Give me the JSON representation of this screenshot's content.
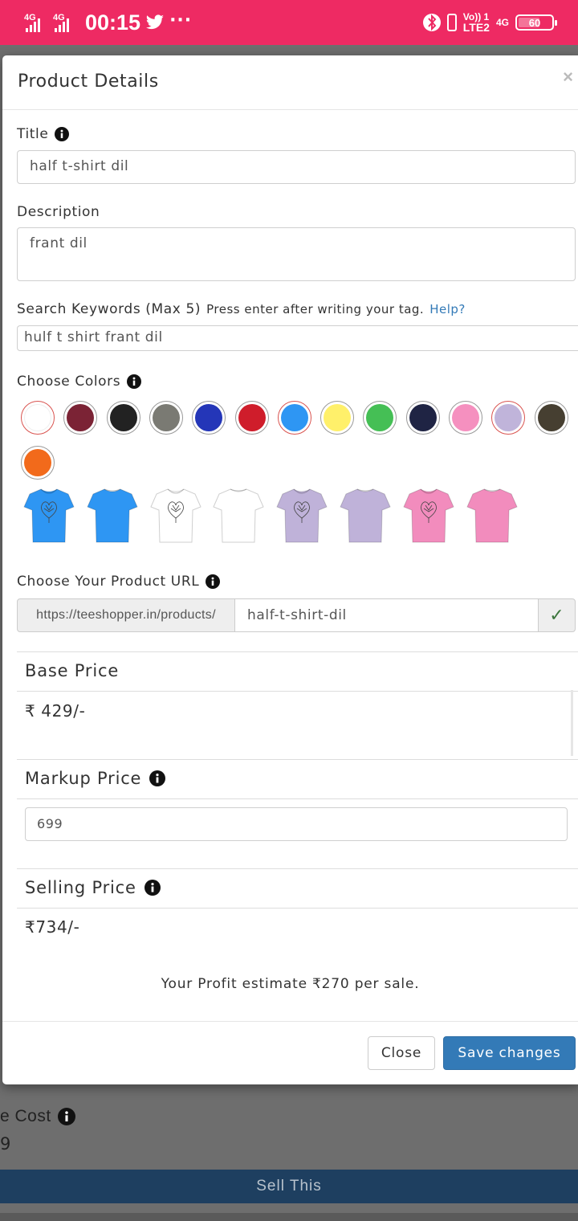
{
  "status_bar": {
    "signal1": "4G",
    "signal2": "4G",
    "time": "00:15",
    "more": "···",
    "volte": "Vo)) 1",
    "lte": "LTE2",
    "net3": "4G",
    "battery": "60"
  },
  "background": {
    "cost_label": "e Cost",
    "cost_value": "9",
    "sell_button": "Sell This"
  },
  "modal": {
    "title": "Product Details",
    "close_x": "×",
    "title_label": "Title",
    "title_value": "half t-shirt dil",
    "description_label": "Description",
    "description_value": "frant dil",
    "keywords_label": "Search Keywords (Max 5)",
    "keywords_hint": "Press enter after writing your tag.",
    "keywords_help": "Help?",
    "keywords_value": "hulf t shirt frant dil",
    "colors_label": "Choose Colors",
    "colors": [
      {
        "name": "white",
        "hex": "#ffffff",
        "ring": "#d9534f"
      },
      {
        "name": "maroon",
        "hex": "#7b2335",
        "ring": "#999999"
      },
      {
        "name": "black",
        "hex": "#222222",
        "ring": "#999999"
      },
      {
        "name": "grey",
        "hex": "#7a7a73",
        "ring": "#999999"
      },
      {
        "name": "royal-blue",
        "hex": "#2436b8",
        "ring": "#999999"
      },
      {
        "name": "red",
        "hex": "#cf1d2b",
        "ring": "#999999"
      },
      {
        "name": "sky-blue",
        "hex": "#2e96f3",
        "ring": "#d9534f"
      },
      {
        "name": "yellow",
        "hex": "#fff06a",
        "ring": "#999999"
      },
      {
        "name": "green",
        "hex": "#45bf55",
        "ring": "#999999"
      },
      {
        "name": "navy",
        "hex": "#1f2444",
        "ring": "#999999"
      },
      {
        "name": "pink",
        "hex": "#f590bf",
        "ring": "#999999"
      },
      {
        "name": "lavender",
        "hex": "#c0b4da",
        "ring": "#d9534f"
      },
      {
        "name": "olive-brown",
        "hex": "#463f31",
        "ring": "#999999"
      },
      {
        "name": "orange",
        "hex": "#f26a1b",
        "ring": "#999999"
      }
    ],
    "shirts": [
      {
        "color": "#2e96f3",
        "side": "front"
      },
      {
        "color": "#2e96f3",
        "side": "back"
      },
      {
        "color": "#ffffff",
        "side": "front"
      },
      {
        "color": "#ffffff",
        "side": "back"
      },
      {
        "color": "#bfb2d9",
        "side": "front"
      },
      {
        "color": "#bfb2d9",
        "side": "back"
      },
      {
        "color": "#f28cbd",
        "side": "front"
      },
      {
        "color": "#f28cbd",
        "side": "back"
      }
    ],
    "url_label": "Choose Your Product URL",
    "url_prefix": "https://teeshopper.in/products/",
    "url_slug": "half-t-shirt-dil",
    "url_check": "✓",
    "base_price_label": "Base Price",
    "base_price_value": "₹ 429/-",
    "markup_price_label": "Markup Price",
    "markup_price_value": "699",
    "selling_price_label": "Selling Price",
    "selling_price_value": "₹734/-",
    "profit_text": "Your Profit estimate ₹270 per sale.",
    "close_button": "Close",
    "save_button": "Save changes"
  },
  "colors_ui": {
    "status_bar": "#ee2a63",
    "primary": "#337ab7",
    "sell_bar": "#1e3f60"
  }
}
